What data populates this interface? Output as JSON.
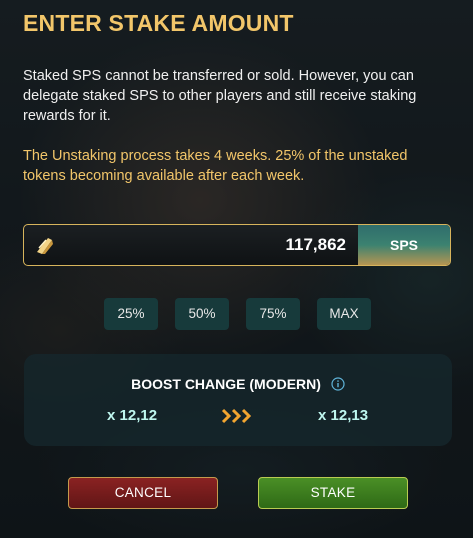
{
  "dialog": {
    "title": "ENTER STAKE AMOUNT",
    "description": "Staked SPS cannot be transferred or sold. However, you can delegate staked SPS to other players and still receive staking rewards for it.",
    "unstaking_note": "The Unstaking process takes 4 weeks. 25% of the unstaked tokens becoming available after each week."
  },
  "stake_input": {
    "token_icon": "sps-token-icon",
    "amount": "117,862",
    "currency": "SPS"
  },
  "quick_amounts": [
    "25%",
    "50%",
    "75%",
    "MAX"
  ],
  "boost": {
    "title": "BOOST CHANGE (MODERN)",
    "info_icon": "info-icon",
    "current": "x 12,12",
    "arrow_icon": "triple-chevron-right-icon",
    "new": "x 12,13"
  },
  "buttons": {
    "cancel": "CANCEL",
    "stake": "STAKE"
  },
  "colors": {
    "accent_gold": "#f2c66a",
    "boost_value": "#bff7ef",
    "cancel_red": "#8a2222",
    "stake_green": "#4a8f26",
    "chip_bg": "#173a3b"
  }
}
